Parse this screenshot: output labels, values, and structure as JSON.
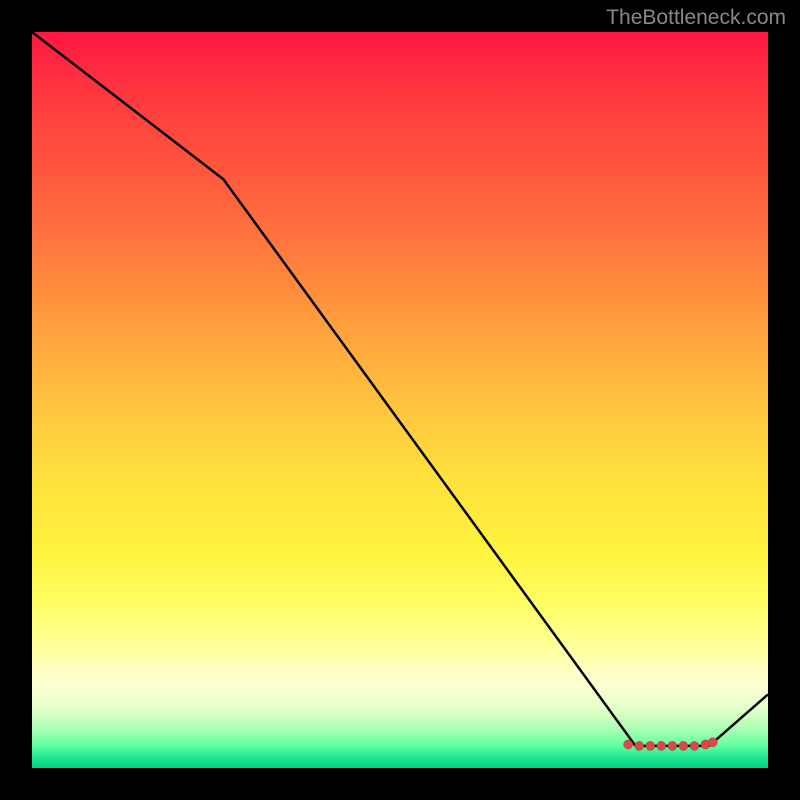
{
  "watermark": "TheBottleneck.com",
  "chart_data": {
    "type": "line",
    "title": "",
    "xlabel": "",
    "ylabel": "",
    "xlim": [
      0,
      100
    ],
    "ylim": [
      0,
      100
    ],
    "series": [
      {
        "name": "curve",
        "points": [
          {
            "x": 0,
            "y": 100
          },
          {
            "x": 26,
            "y": 80
          },
          {
            "x": 82,
            "y": 3
          },
          {
            "x": 92,
            "y": 3
          },
          {
            "x": 100,
            "y": 10
          }
        ]
      },
      {
        "name": "markers",
        "points": [
          {
            "x": 81,
            "y": 3.2
          },
          {
            "x": 82.5,
            "y": 3
          },
          {
            "x": 84,
            "y": 3
          },
          {
            "x": 85.5,
            "y": 3
          },
          {
            "x": 87,
            "y": 3
          },
          {
            "x": 88.5,
            "y": 3
          },
          {
            "x": 90,
            "y": 3
          },
          {
            "x": 91.5,
            "y": 3.2
          },
          {
            "x": 92.5,
            "y": 3.5
          }
        ]
      }
    ],
    "gradient_description": "vertical gradient red (top) through orange to yellow to green (bottom)"
  }
}
